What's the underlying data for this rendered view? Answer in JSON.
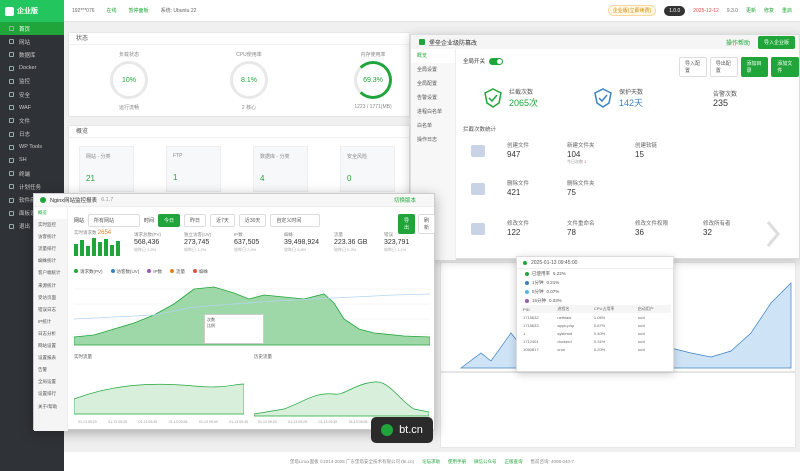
{
  "sidebar": {
    "brand": "企业版",
    "items": [
      {
        "label": "首页",
        "active": true
      },
      {
        "label": "网站"
      },
      {
        "label": "数据库"
      },
      {
        "label": "Docker"
      },
      {
        "label": "监控"
      },
      {
        "label": "安全"
      },
      {
        "label": "WAF"
      },
      {
        "label": "文件"
      },
      {
        "label": "日志"
      },
      {
        "label": "WP Tools"
      },
      {
        "label": "SH"
      },
      {
        "label": "终端"
      },
      {
        "label": "计划任务"
      },
      {
        "label": "软件商店"
      },
      {
        "label": "面板设置"
      },
      {
        "label": "退出"
      }
    ]
  },
  "topbar": {
    "host": "192***076",
    "items": [
      "在线",
      "暂停面板",
      "系统: Ubuntu 22"
    ],
    "plan": "企业版(立即续费)",
    "user_pill": "1.0.0",
    "expire": "2025-12-12",
    "version": "9.3.0",
    "links": [
      "更新",
      "修复",
      "重启"
    ]
  },
  "status": {
    "title": "状态",
    "gauges": [
      {
        "label": "负载状态",
        "value": "10%",
        "sub": "运行流畅"
      },
      {
        "label": "CPU使用率",
        "value": "8.1%",
        "sub": "2 核心"
      },
      {
        "label": "内存使用率",
        "value": "69.3%",
        "sub": "1223 / 1771(MB)"
      }
    ]
  },
  "overview": {
    "title": "概览",
    "boxes": [
      {
        "label": "网站 - 分类",
        "value": "21"
      },
      {
        "label": "FTP",
        "value": "1"
      },
      {
        "label": "数据库 - 分类",
        "value": "4"
      },
      {
        "label": "安全风险",
        "value": "0"
      }
    ]
  },
  "tamper": {
    "title": "堡垒企业级防篡改",
    "help": "操作帮助",
    "corner_btn": "导入企业版",
    "menu": [
      "概览",
      "全局设置",
      "全局配置",
      "告警设置",
      "进程白名单",
      "白名单",
      "操作日志"
    ],
    "global_switch": "全局开关",
    "buttons": [
      "导入配置",
      "导出配置",
      "添加目录",
      "添加文件"
    ],
    "summary": [
      {
        "label": "拦截次数",
        "value": "2065次"
      },
      {
        "label": "保护天数",
        "value": "142天"
      },
      {
        "label": "告警次数",
        "value": "235"
      }
    ],
    "section": "拦截次数统计",
    "rows": [
      [
        {
          "k": "创建文件",
          "v": "947"
        },
        {
          "k": "新建文件夹",
          "v": "104",
          "extra": "今日次数",
          "extra_v": "1"
        },
        {
          "k": "创建软链",
          "v": "15"
        }
      ],
      [
        {
          "k": "删除文件",
          "v": "421"
        },
        {
          "k": "删除文件夹",
          "v": "75"
        }
      ],
      [
        {
          "k": "修改文件",
          "v": "122"
        },
        {
          "k": "文件重命名",
          "v": "78"
        },
        {
          "k": "修改文件权限",
          "v": "36"
        },
        {
          "k": "修改所有者",
          "v": "32"
        }
      ]
    ]
  },
  "nginx": {
    "title": "Nginx网站监控报表",
    "version": "6.1.7",
    "corner": "切换版本",
    "menu": [
      "概览",
      "实时监控",
      "访客统计",
      "流量排行",
      "蜘蛛统计",
      "客户端统计",
      "来源统计",
      "受访页面",
      "错误日志",
      "IP统计",
      "日志分析",
      "网站设置",
      "设置报表",
      "告警",
      "全局设置",
      "设置排行",
      "关于/帮助"
    ],
    "site_label": "网站",
    "site_value": "所有网站",
    "time_label": "时间",
    "time_tabs": [
      "今日",
      "昨日",
      "近7天",
      "近30天",
      "自定义时间"
    ],
    "export_btn": "导出",
    "refresh_btn": "刷新",
    "realtime_label": "实时请求数",
    "realtime_value": "2654",
    "stats": [
      {
        "k": "请求总数(PV)",
        "v": "568,436",
        "s": "较昨日 3.5%"
      },
      {
        "k": "独立访客(UV)",
        "v": "273,745",
        "s": "较昨日 1.2%"
      },
      {
        "k": "IP数",
        "v": "637,505",
        "s": "较昨日 2.4%"
      },
      {
        "k": "蜘蛛",
        "v": "39,498,924",
        "s": "较昨日 5.8%"
      },
      {
        "k": "流量",
        "v": "223.36 GB",
        "s": "较昨日 0.3%"
      },
      {
        "k": "错误",
        "v": "323,791",
        "s": "较昨日 1.1%"
      }
    ],
    "legend": [
      "请求数(PV)",
      "访客数(UV)",
      "IP数",
      "流量",
      "蜘蛛"
    ],
    "chart_left_label": "实时流量",
    "chart_right_label": "历史流量",
    "tooltip_rows": [
      "次数",
      "比例"
    ]
  },
  "proc": {
    "time": "2025-01-13 09:45:00",
    "rows": [
      {
        "label": "已使用率",
        "value": "5.22%"
      },
      {
        "label": "1分钟",
        "value": "0.21%"
      },
      {
        "label": "5分钟",
        "value": "0.07%"
      },
      {
        "label": "15分钟",
        "value": "0.03%"
      }
    ],
    "headers": [
      "PID",
      "进程名",
      "CPU占用率",
      "启动用户"
    ],
    "table": [
      [
        "1715632",
        "nethlaw",
        "1.06%",
        "root"
      ],
      [
        "1715633",
        "apps-php",
        "0.67%",
        "root"
      ],
      [
        "1",
        "systemd",
        "0.40%",
        "root"
      ],
      [
        "1712401",
        "dockerd",
        "0.31%",
        "root"
      ],
      [
        "1050817",
        "cron",
        "0.20%",
        "root"
      ]
    ]
  },
  "axis_times": [
    "01-13 09:20",
    "01-13 09:25",
    "01-13 09:30",
    "01-13 09:35",
    "01-13 09:40",
    "01-13 09:45"
  ],
  "footer": {
    "text": "堡塔Linux面板 ©2014-2025 广东堡塔安全技术有限公司 (bt.cn)",
    "links": [
      "论坛求助",
      "使用手册",
      "微信公众号",
      "正版查询",
      "售前咨询: 4008-040-7"
    ]
  },
  "badge": {
    "text": "bt.cn"
  },
  "colors": {
    "accent": "#20a53a",
    "sidebar": "#2f3237"
  }
}
